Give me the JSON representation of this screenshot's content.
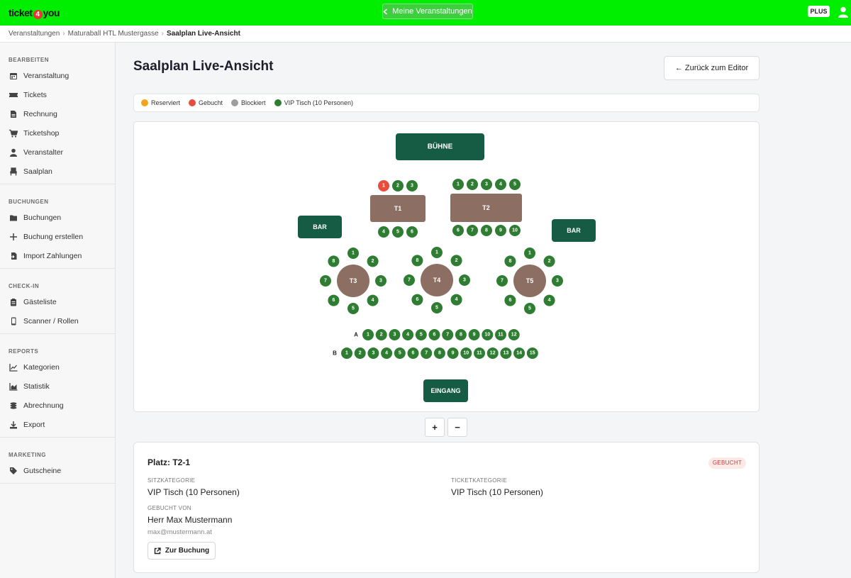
{
  "topbar": {
    "logo_left": "ticket",
    "logo_num": "4",
    "logo_right": "you",
    "center_button": "Meine Veranstaltungen",
    "plan_badge": "PLUS",
    "brand_color": "#00ee00"
  },
  "breadcrumb": {
    "items": [
      "Veranstaltungen",
      "Maturaball HTL Mustergasse",
      "Saalplan Live-Ansicht"
    ]
  },
  "sidebar": {
    "sections": [
      {
        "title": "BEARBEITEN",
        "items": [
          {
            "label": "Veranstaltung",
            "icon": "calendar-icon"
          },
          {
            "label": "Tickets",
            "icon": "ticket-icon"
          },
          {
            "label": "Rechnung",
            "icon": "invoice-icon"
          },
          {
            "label": "Ticketshop",
            "icon": "cart-icon"
          },
          {
            "label": "Veranstalter",
            "icon": "user-icon"
          },
          {
            "label": "Saalplan",
            "icon": "chair-icon"
          }
        ]
      },
      {
        "title": "BUCHUNGEN",
        "items": [
          {
            "label": "Buchungen",
            "icon": "folder-icon"
          },
          {
            "label": "Buchung erstellen",
            "icon": "plus-icon"
          },
          {
            "label": "Import Zahlungen",
            "icon": "file-import-icon"
          }
        ]
      },
      {
        "title": "CHECK-IN",
        "items": [
          {
            "label": "Gästeliste",
            "icon": "clipboard-icon"
          },
          {
            "label": "Scanner / Rollen",
            "icon": "phone-icon"
          }
        ]
      },
      {
        "title": "REPORTS",
        "items": [
          {
            "label": "Kategorien",
            "icon": "line-chart-icon"
          },
          {
            "label": "Statistik",
            "icon": "area-chart-icon"
          },
          {
            "label": "Abrechnung",
            "icon": "coins-icon"
          },
          {
            "label": "Export",
            "icon": "download-icon"
          }
        ]
      },
      {
        "title": "MARKETING",
        "items": [
          {
            "label": "Gutscheine",
            "icon": "tags-icon"
          }
        ]
      }
    ]
  },
  "page": {
    "title": "Saalplan Live-Ansicht",
    "back_button": "← Zurück zum Editor"
  },
  "legend": [
    {
      "label": "Reserviert",
      "color": "#f7a21b"
    },
    {
      "label": "Gebucht",
      "color": "#e74c3c"
    },
    {
      "label": "Blockiert",
      "color": "#9e9e9e"
    },
    {
      "label": "VIP Tisch (10 Personen)",
      "color": "#2e7d32"
    }
  ],
  "plan": {
    "stage_label": "BÜHNE",
    "bar_left_label": "BAR",
    "bar_right_label": "BAR",
    "entrance_label": "EINGANG",
    "colors": {
      "area": "#165c45",
      "table": "#8d6e63",
      "seat": "#2e7d32",
      "seat_booked": "#e74c3c"
    },
    "tables": [
      {
        "label": "T1",
        "shape": "rect",
        "top_seats": [
          "1",
          "2",
          "3"
        ],
        "bottom_seats": [
          "4",
          "5",
          "6"
        ],
        "booked": [
          "1"
        ]
      },
      {
        "label": "T2",
        "shape": "rect",
        "top_seats": [
          "1",
          "2",
          "3",
          "4",
          "5"
        ],
        "bottom_seats": [
          "6",
          "7",
          "8",
          "9",
          "10"
        ],
        "booked": []
      },
      {
        "label": "T3",
        "shape": "round",
        "seats": [
          "1",
          "2",
          "3",
          "4",
          "5",
          "6",
          "7",
          "8"
        ],
        "booked": []
      },
      {
        "label": "T4",
        "shape": "round",
        "seats": [
          "1",
          "2",
          "3",
          "4",
          "5",
          "6",
          "7",
          "8"
        ],
        "booked": []
      },
      {
        "label": "T5",
        "shape": "round",
        "seats": [
          "1",
          "2",
          "3",
          "4",
          "5",
          "6",
          "7",
          "8"
        ],
        "booked": []
      }
    ],
    "rows": [
      {
        "label": "A",
        "seats": [
          "1",
          "2",
          "3",
          "4",
          "5",
          "6",
          "7",
          "8",
          "9",
          "10",
          "11",
          "12"
        ]
      },
      {
        "label": "B",
        "seats": [
          "1",
          "2",
          "3",
          "4",
          "5",
          "6",
          "7",
          "8",
          "9",
          "10",
          "11",
          "12",
          "13",
          "14",
          "15"
        ]
      }
    ]
  },
  "zoom": {
    "in_label": "+",
    "out_label": "−"
  },
  "detail": {
    "title": "Platz: T2-1",
    "status": "GEBUCHT",
    "seat_category_label": "SITZKATEGORIE",
    "seat_category_value": "VIP Tisch (10 Personen)",
    "ticket_category_label": "TICKETKATEGORIE",
    "ticket_category_value": "VIP Tisch (10 Personen)",
    "booked_by_label": "GEBUCHT VON",
    "booked_by_name": "Herr Max Mustermann",
    "booked_by_email": "max@mustermann.at",
    "booking_button": "Zur Buchung"
  }
}
